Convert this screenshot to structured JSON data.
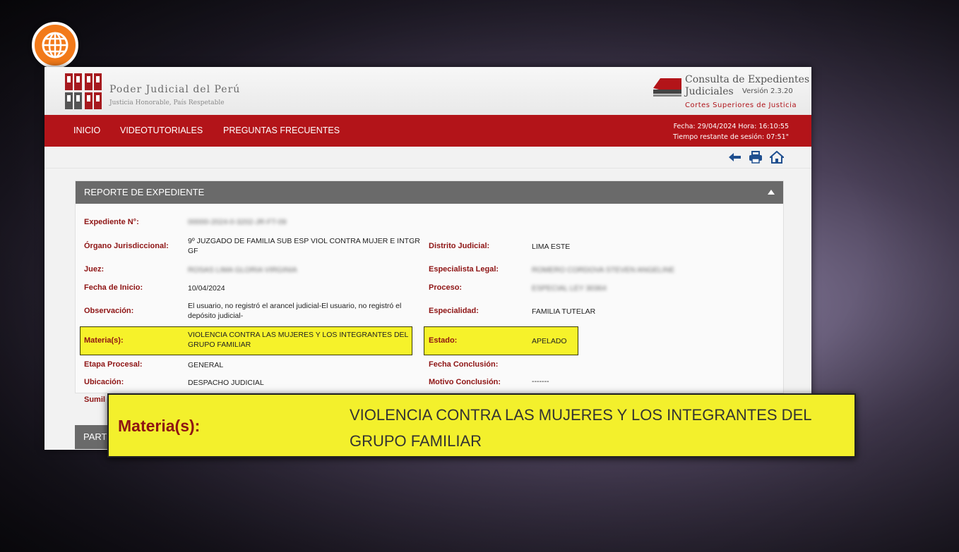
{
  "header": {
    "org_name": "Poder Judicial del Perú",
    "slogan": "Justicia Honorable, País Respetable",
    "app_title_line1": "Consulta de Expedientes",
    "app_title_line2": "Judiciales",
    "version": "Versión 2.3.20",
    "cortes": "Cortes Superiores de Justicia"
  },
  "nav": {
    "items": [
      "INICIO",
      "VIDEOTUTORIALES",
      "PREGUNTAS FRECUENTES"
    ],
    "session_line1": "Fecha: 29/04/2024 Hora: 16:10:55",
    "session_line2": "Tiempo restante de sesión: 07:51\""
  },
  "toolbar": {
    "icons": [
      "back-arrow-icon",
      "print-icon",
      "home-icon"
    ]
  },
  "report": {
    "title": "REPORTE DE EXPEDIENTE",
    "expediente_label": "Expediente N°:",
    "expediente_value": "00000-2024-0-3202-JR-FT-09",
    "organo_label": "Órgano Jurisdiccional:",
    "organo_value": "9º JUZGADO DE FAMILIA SUB ESP VIOL CONTRA MUJER E INTGR GF",
    "distrito_label": "Distrito Judicial:",
    "distrito_value": "LIMA ESTE",
    "juez_label": "Juez:",
    "juez_value": "ROSAS LIMA GLORIA VIRGINIA",
    "especialista_label": "Especialista Legal:",
    "especialista_value": "ROMERO CORDOVA STEVEN ANGELINE",
    "fecha_inicio_label": "Fecha de Inicio:",
    "fecha_inicio_value": "10/04/2024",
    "proceso_label": "Proceso:",
    "proceso_value": "ESPECIAL LEY 30364",
    "observacion_label": "Observación:",
    "observacion_value": "El usuario, no registró el arancel judicial-El usuario, no registró el depósito judicial-",
    "especialidad_label": "Especialidad:",
    "especialidad_value": "FAMILIA TUTELAR",
    "materia_label": "Materia(s):",
    "materia_value": "VIOLENCIA CONTRA LAS MUJERES Y LOS INTEGRANTES DEL GRUPO FAMILIAR",
    "estado_label": "Estado:",
    "estado_value": "APELADO",
    "etapa_label": "Etapa Procesal:",
    "etapa_value": "GENERAL",
    "fecha_conclusion_label": "Fecha Conclusión:",
    "fecha_conclusion_value": "",
    "ubicacion_label": "Ubicación:",
    "ubicacion_value": "DESPACHO JUDICIAL",
    "motivo_label": "Motivo Conclusión:",
    "motivo_value": "-------",
    "sumilla_label": "Sumil"
  },
  "section2": {
    "title": "PART"
  },
  "overlay": {
    "label": "Materia(s):",
    "value": "VIOLENCIA CONTRA LAS MUJERES Y LOS INTEGRANTES DEL GRUPO FAMILIAR"
  },
  "colors": {
    "nav_red": "#b31419",
    "label_red": "#8e1414",
    "highlight_yellow": "#f6f22a",
    "panel_gray": "#6a6a6a",
    "broadcaster_orange": "#f27a1a"
  }
}
